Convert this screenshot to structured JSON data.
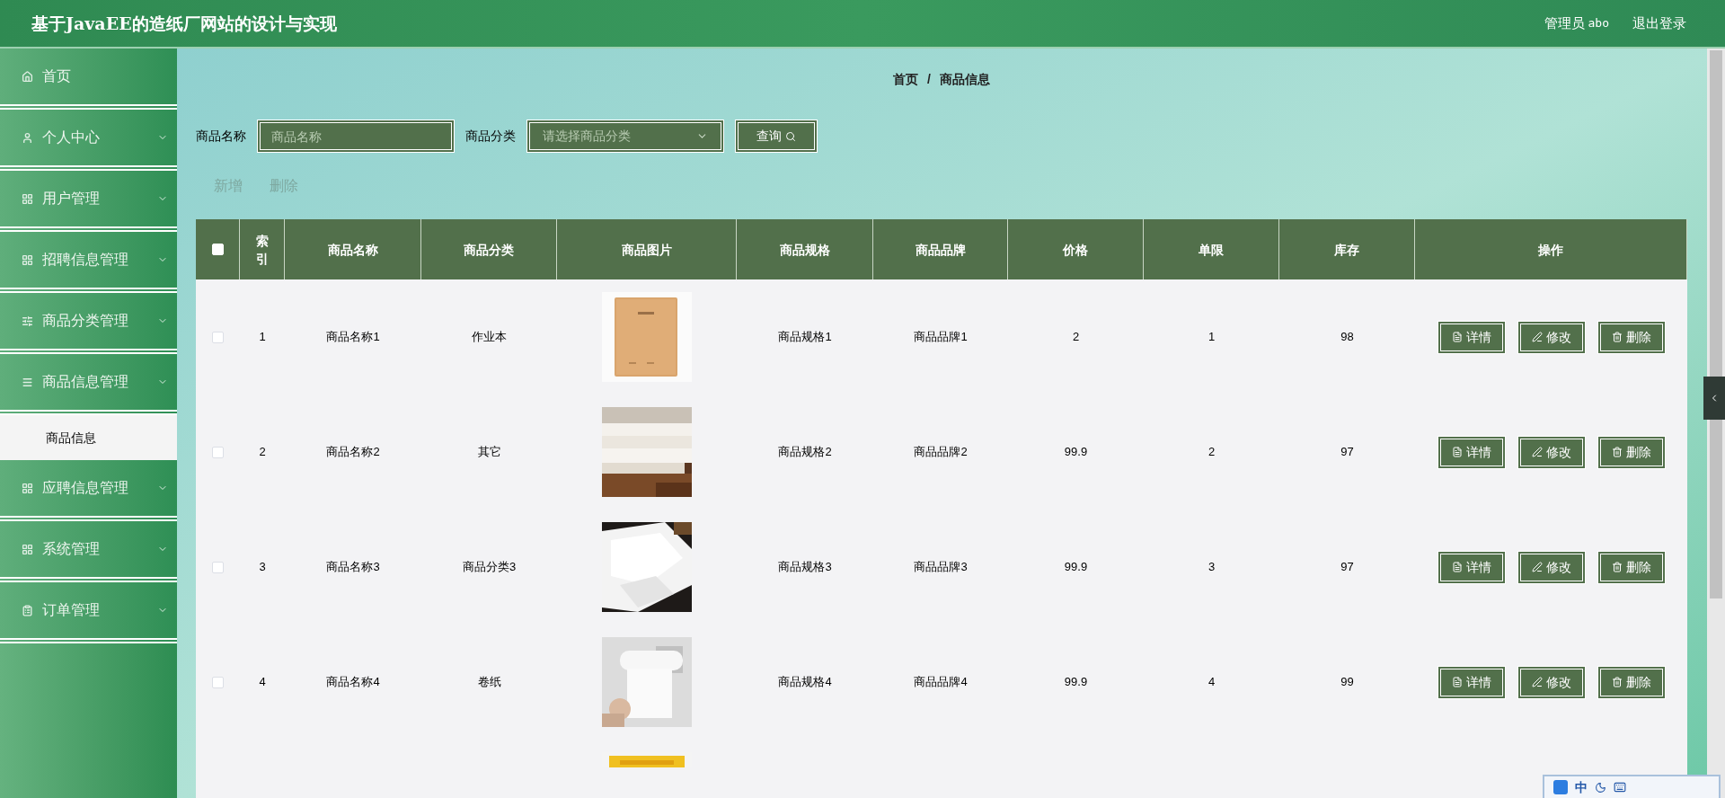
{
  "header": {
    "title": "基于JavaEE的造纸厂网站的设计与实现",
    "role": "管理员",
    "username": "abo",
    "logout": "退出登录"
  },
  "sidebar": {
    "items": [
      {
        "label": "首页",
        "kind": "link",
        "selected": false
      },
      {
        "label": "个人中心",
        "kind": "menu",
        "selected": false
      },
      {
        "label": "用户管理",
        "kind": "menu",
        "selected": false
      },
      {
        "label": "招聘信息管理",
        "kind": "menu",
        "selected": false
      },
      {
        "label": "商品分类管理",
        "kind": "menu",
        "selected": false
      },
      {
        "label": "商品信息管理",
        "kind": "menu",
        "selected": false,
        "children": [
          {
            "label": "商品信息",
            "selected": true
          }
        ]
      },
      {
        "label": "应聘信息管理",
        "kind": "menu",
        "selected": false
      },
      {
        "label": "系统管理",
        "kind": "menu",
        "selected": false
      },
      {
        "label": "订单管理",
        "kind": "menu",
        "selected": false
      }
    ]
  },
  "breadcrumb": {
    "items": [
      "首页",
      "商品信息"
    ],
    "separator": "/"
  },
  "search": {
    "name_label": "商品名称",
    "name_placeholder": "商品名称",
    "category_label": "商品分类",
    "category_placeholder": "请选择商品分类",
    "query_button": "查询"
  },
  "toolbar": [
    "新增",
    "删除"
  ],
  "table": {
    "header_checked": false,
    "columns": [
      "索引",
      "商品名称",
      "商品分类",
      "商品图片",
      "商品规格",
      "商品品牌",
      "价格",
      "单限",
      "库存",
      "操作"
    ],
    "rows": [
      {
        "checked": false,
        "cells": [
          "1",
          "商品名称1",
          "作业本",
          {
            "kind": "picture"
          },
          "商品规格1",
          "商品品牌1",
          "2",
          "1",
          "98"
        ],
        "actions": [
          "详情",
          "修改",
          "删除"
        ]
      },
      {
        "checked": false,
        "cells": [
          "2",
          "商品名称2",
          "其它",
          {
            "kind": "picture"
          },
          "商品规格2",
          "商品品牌2",
          "99.9",
          "2",
          "97"
        ],
        "actions": [
          "详情",
          "修改",
          "删除"
        ]
      },
      {
        "checked": false,
        "cells": [
          "3",
          "商品名称3",
          "商品分类3",
          {
            "kind": "picture"
          },
          "商品规格3",
          "商品品牌3",
          "99.9",
          "3",
          "97"
        ],
        "actions": [
          "详情",
          "修改",
          "删除"
        ]
      },
      {
        "checked": false,
        "cells": [
          "4",
          "商品名称4",
          "卷纸",
          {
            "kind": "picture"
          },
          "商品规格4",
          "商品品牌4",
          "99.9",
          "4",
          "99"
        ],
        "actions": [
          "详情",
          "修改",
          "删除"
        ]
      },
      {
        "cells": [
          null,
          null,
          null,
          {
            "kind": "picture"
          }
        ]
      }
    ]
  },
  "ime": {
    "mode": "中"
  }
}
